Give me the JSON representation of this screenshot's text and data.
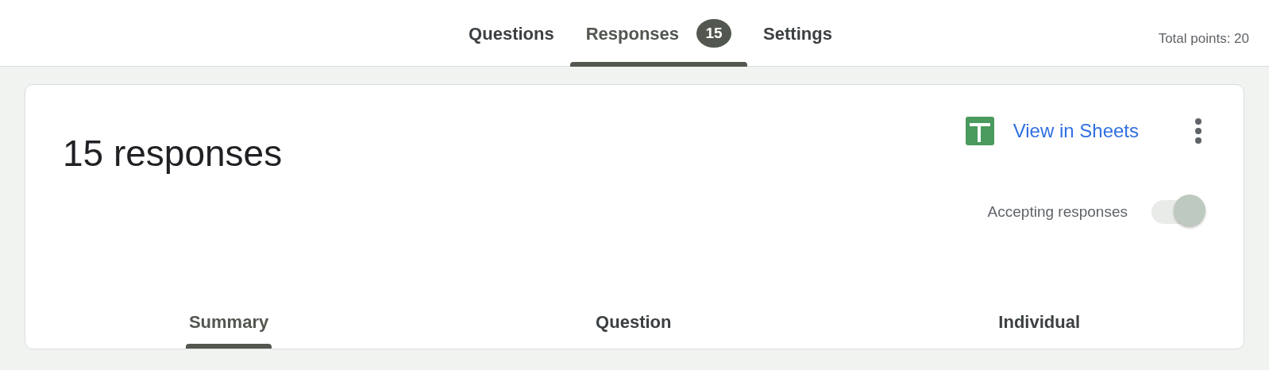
{
  "tabs": [
    {
      "label": "Questions",
      "selected": false
    },
    {
      "label": "Responses",
      "selected": true,
      "badge": "15"
    },
    {
      "label": "Settings",
      "selected": false
    }
  ],
  "total_points": "Total points: 20",
  "card": {
    "title": "15 responses",
    "sheets_link": "View in Sheets",
    "accepting": {
      "label": "Accepting responses",
      "on": true
    },
    "subtabs": [
      {
        "label": "Summary",
        "selected": true
      },
      {
        "label": "Question",
        "selected": false
      },
      {
        "label": "Individual",
        "selected": false
      }
    ]
  }
}
